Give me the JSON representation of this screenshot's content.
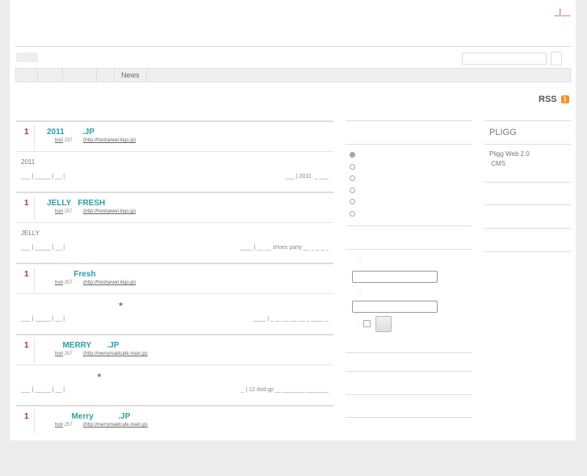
{
  "header": {
    "top_links": "_|__"
  },
  "nav": {
    "items": [
      "",
      "",
      "",
      "",
      "News"
    ],
    "search_placeholder": ""
  },
  "rss": {
    "label": "RSS",
    "icon": "rss-icon"
  },
  "stories": [
    {
      "votes": "1",
      "title": "2011        .JP",
      "user": "hori",
      "num": "237",
      "url": "(http://freshjewel.itigo.jp)",
      "desc": "2011",
      "footer_left": "___ | _____  |  __ |",
      "footer_right": "___ | 2011  _ ___"
    },
    {
      "votes": "1",
      "title": "JELLY   FRESH",
      "user": "hori",
      "num": "257",
      "url": "(http://freshjewel.itigo.jp)",
      "desc": "JELLY",
      "footer_left": "___ | _____  |  __ |",
      "footer_right": "____ | __ __ shoes party __ _ _ _ _"
    },
    {
      "votes": "1",
      "title": "            Fresh",
      "user": "hori",
      "num": "257",
      "url": "(http://freshjewel.itigo.jp)",
      "desc": "                                                      ★",
      "footer_left": "___ | _____  |  __ |",
      "footer_right": "____ | _ __ __ __ __ _ ____ _"
    },
    {
      "votes": "1",
      "title": "       MERRY       .JP",
      "user": "hori",
      "num": "257",
      "url": "(http://merrymaidcafe.main.jp)",
      "desc": "                                          ★",
      "footer_left": "___ | _____  |  __ |",
      "footer_right": "_ | 12 dvd gp __ _______ _______"
    },
    {
      "votes": "1",
      "title": "           Merry           .JP",
      "user": "hori",
      "num": "257",
      "url": "(http://merrymaidcafe.main.jp)",
      "desc": "",
      "footer_left": "",
      "footer_right": ""
    }
  ],
  "sidebar_mid": {
    "radio_selected": 0,
    "radio_count": 6,
    "login_colon": ":",
    "remember_colon": ":"
  },
  "sidebar_right": {
    "title": "PLIGG",
    "text1": "Pligg  Web 2.0",
    "text2": " CMS"
  }
}
